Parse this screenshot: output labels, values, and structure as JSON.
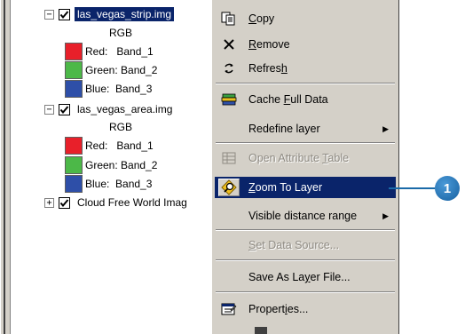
{
  "toc": {
    "layers": [
      {
        "name": "las_vegas_strip.img",
        "expanded": true,
        "checked": true,
        "selected": true,
        "render_label": "RGB",
        "bands": [
          {
            "label": "Red:   Band_1",
            "color": "#e8202a"
          },
          {
            "label": "Green: Band_2",
            "color": "#4cb848"
          },
          {
            "label": "Blue:  Band_3",
            "color": "#2e4fa8"
          }
        ]
      },
      {
        "name": "las_vegas_area.img",
        "expanded": true,
        "checked": true,
        "selected": false,
        "render_label": "RGB",
        "bands": [
          {
            "label": "Red:   Band_1",
            "color": "#e8202a"
          },
          {
            "label": "Green: Band_2",
            "color": "#4cb848"
          },
          {
            "label": "Blue:  Band_3",
            "color": "#2e4fa8"
          }
        ]
      },
      {
        "name": "Cloud Free World Imag",
        "expanded": false,
        "checked": true,
        "selected": false
      }
    ]
  },
  "context_menu": {
    "items": [
      {
        "label_pre": "",
        "label_u": "C",
        "label_post": "opy",
        "icon": "copy-icon",
        "disabled": false
      },
      {
        "label_pre": "",
        "label_u": "R",
        "label_post": "emove",
        "icon": "remove-x-icon",
        "disabled": false
      },
      {
        "label_pre": "Refres",
        "label_u": "h",
        "label_post": "",
        "icon": "refresh-icon",
        "disabled": false
      },
      {
        "label_pre": "Cache ",
        "label_u": "F",
        "label_post": "ull Data",
        "icon": "cache-icon",
        "disabled": false
      },
      {
        "label_pre": "Redefine layer",
        "label_u": "",
        "label_post": "",
        "icon": "",
        "disabled": false,
        "submenu": true
      },
      {
        "label_pre": "Open Attribute ",
        "label_u": "T",
        "label_post": "able",
        "icon": "table-icon",
        "disabled": true
      },
      {
        "label_pre": "",
        "label_u": "Z",
        "label_post": "oom To Layer",
        "icon": "zoom-to-layer-icon",
        "disabled": false,
        "highlighted": true
      },
      {
        "label_pre": "Visible distance range",
        "label_u": "",
        "label_post": "",
        "icon": "",
        "disabled": false,
        "submenu": true
      },
      {
        "label_pre": "",
        "label_u": "S",
        "label_post": "et Data Source...",
        "icon": "",
        "disabled": true
      },
      {
        "label_pre": "Save As La",
        "label_u": "y",
        "label_post": "er File...",
        "icon": "",
        "disabled": false
      },
      {
        "label_pre": "Propert",
        "label_u": "i",
        "label_post": "es...",
        "icon": "properties-icon",
        "disabled": false
      }
    ]
  },
  "callout": {
    "number": "1",
    "color": "#1660a0"
  }
}
